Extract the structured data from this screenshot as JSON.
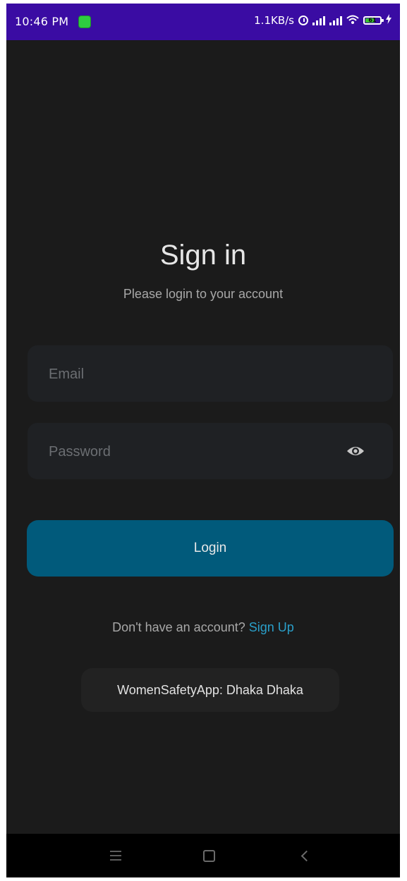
{
  "status_bar": {
    "time": "10:46 PM",
    "net_speed": "1.1KB/s",
    "battery_level": "61",
    "icons": [
      "app-notification-icon",
      "alarm-icon",
      "signal-icon",
      "signal-icon",
      "wifi-icon",
      "battery-icon",
      "charging-icon"
    ]
  },
  "login": {
    "title": "Sign in",
    "subtitle": "Please login to your account",
    "email_placeholder": "Email",
    "email_value": "",
    "password_placeholder": "Password",
    "password_value": "",
    "login_label": "Login",
    "signup_prompt": "Don't have an account?",
    "signup_link": "Sign Up"
  },
  "toast": {
    "message": "WomenSafetyApp: Dhaka Dhaka"
  },
  "nav_bar": {
    "buttons": [
      "menu-icon",
      "home-icon",
      "back-icon"
    ]
  },
  "colors": {
    "status_bar": "#3a0ca3",
    "background": "#1b1b1b",
    "input_background": "#1f2124",
    "login_button": "#015a7b",
    "link": "#2a9fc9",
    "nav_bar": "#000000"
  }
}
